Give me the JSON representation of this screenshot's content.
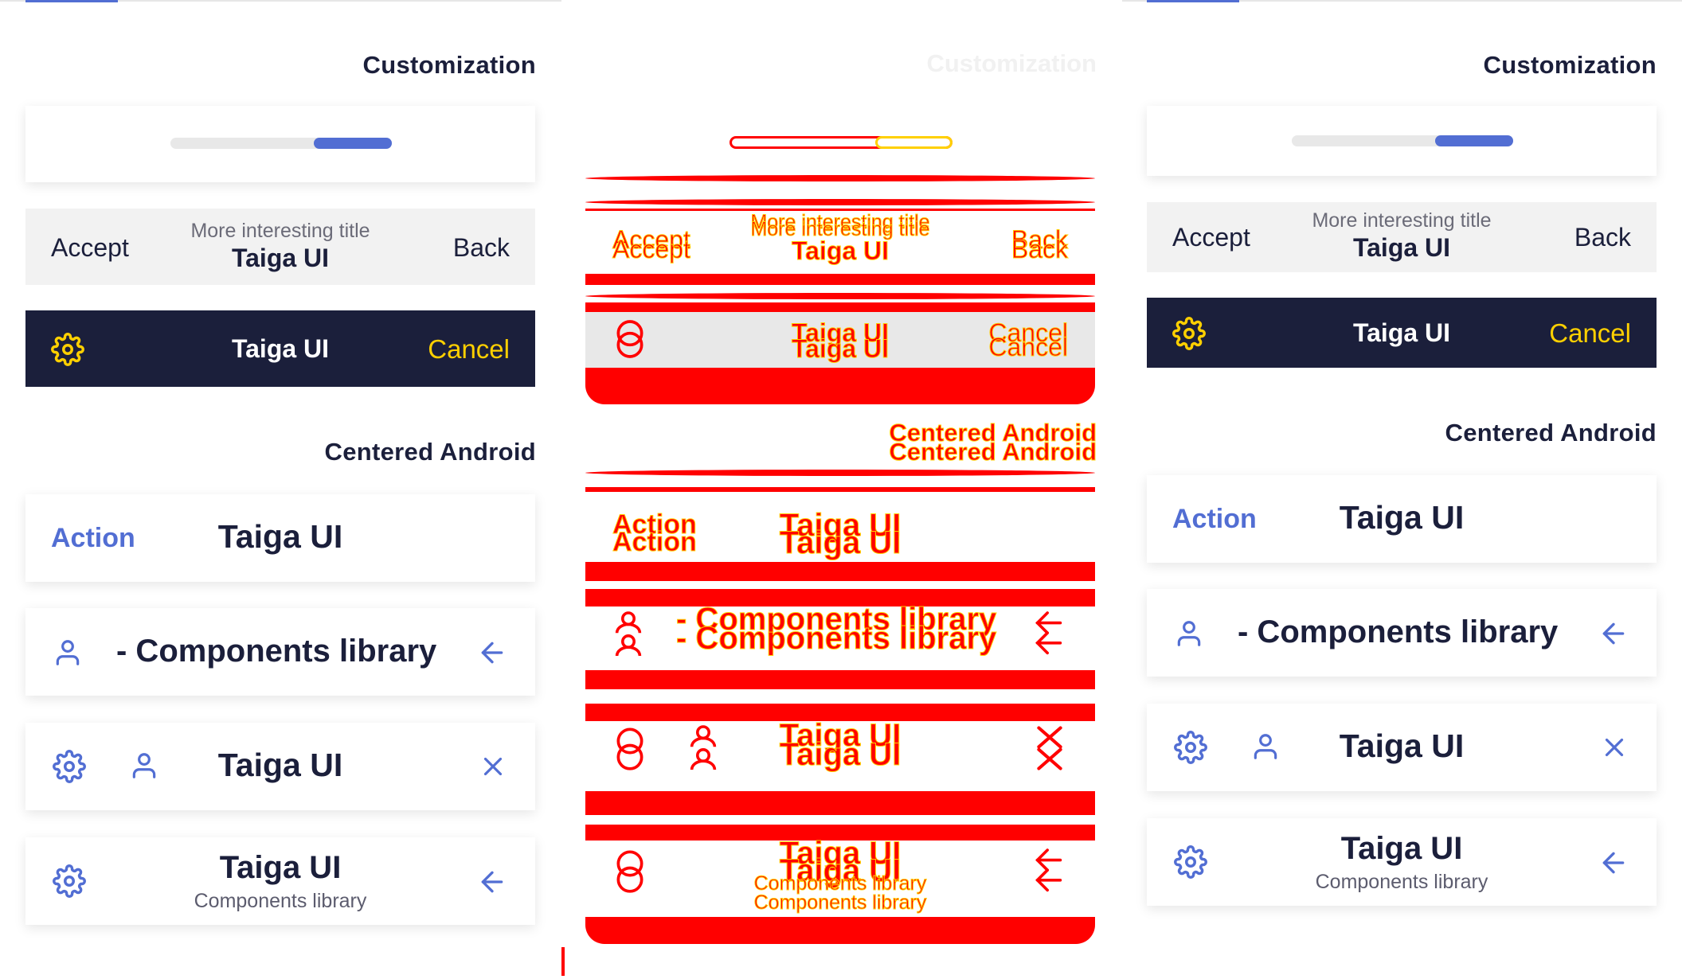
{
  "sections": {
    "customization": "Customization",
    "centered_android": "Centered Android"
  },
  "progress": {
    "value": 0.35
  },
  "bar_grey": {
    "left": "Accept",
    "subtitle": "More interesting title",
    "title": "Taiga UI",
    "right": "Back"
  },
  "bar_dark": {
    "title": "Taiga UI",
    "right": "Cancel"
  },
  "android": {
    "action_bar": {
      "left": "Action",
      "title": "Taiga UI"
    },
    "marquee_bar": {
      "title_marquee": "- Components library"
    },
    "icons_bar": {
      "title": "Taiga UI"
    },
    "subtitle_bar": {
      "title": "Taiga UI",
      "subtitle": "Components library"
    }
  },
  "colors": {
    "accent": "#526ed3",
    "dark_bar": "#1b1f3b",
    "warning": "#ffd000",
    "overlay_red": "#ff0000"
  },
  "icons": [
    "gear-icon",
    "user-icon",
    "arrow-left-icon",
    "close-icon"
  ]
}
